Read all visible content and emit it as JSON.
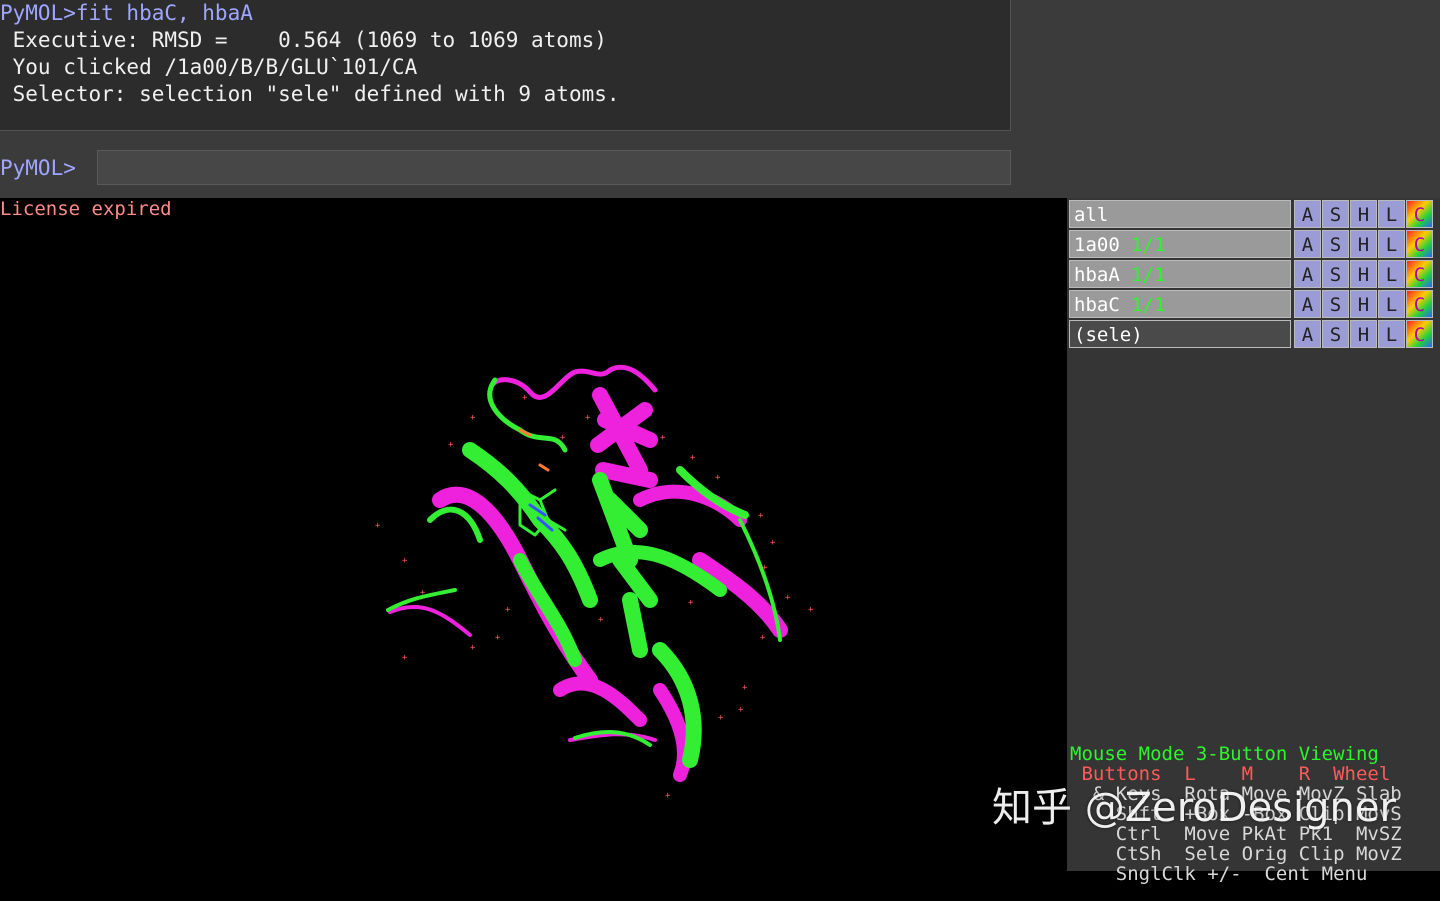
{
  "console": {
    "lines": [
      "PyMOL>fit hbaC, hbaA",
      " Executive: RMSD =    0.564 (1069 to 1069 atoms)",
      " You clicked /1a00/B/B/GLU`101/CA",
      " Selector: selection \"sele\" defined with 9 atoms."
    ],
    "prompt": "PyMOL>",
    "input_value": ""
  },
  "viewer": {
    "license_text": "License expired"
  },
  "objects": [
    {
      "name": "all",
      "state": "",
      "buttons": [
        "A",
        "S",
        "H",
        "L",
        "C"
      ]
    },
    {
      "name": "1a00",
      "state": "1/1",
      "buttons": [
        "A",
        "S",
        "H",
        "L",
        "C"
      ]
    },
    {
      "name": "hbaA",
      "state": "1/1",
      "buttons": [
        "A",
        "S",
        "H",
        "L",
        "C"
      ]
    },
    {
      "name": "hbaC",
      "state": "1/1",
      "buttons": [
        "A",
        "S",
        "H",
        "L",
        "C"
      ]
    },
    {
      "name": "(sele)",
      "state": "",
      "buttons": [
        "A",
        "S",
        "H",
        "L",
        "C"
      ]
    }
  ],
  "mouse_panel": {
    "mode_line": "Mouse Mode 3-Button Viewing",
    "buttons_line": " Buttons  L    M    R  Wheel",
    "rows": [
      "  & Keys  Rota Move MovZ Slab",
      "    Shft  +Box -Box Clip MovS",
      "    Ctrl  Move PkAt Pk1  MvSZ",
      "    CtSh  Sele Orig Clip MovZ",
      "    SnglClk +/-  Cent Menu"
    ]
  },
  "watermark": "知乎 @ZeroDesigner",
  "colors": {
    "console_text": "#f0f0f0",
    "prompt": "#9fa6ff",
    "license": "#ff8a8a",
    "state": "#2cf52c",
    "mode": "#2cf52c",
    "buttons_header": "#6e6eff",
    "protein_green": "#33ee33",
    "protein_magenta": "#ee22dd"
  }
}
